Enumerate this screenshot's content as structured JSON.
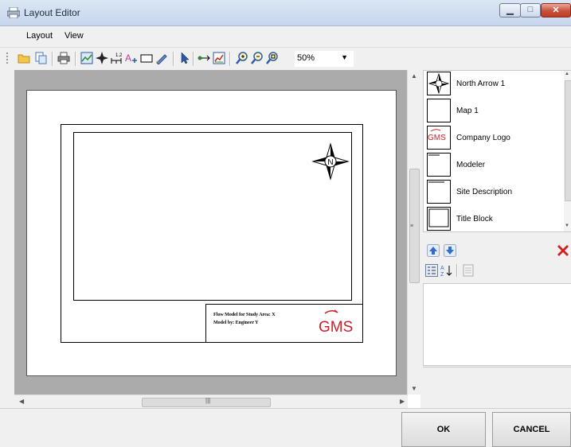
{
  "window": {
    "title": "Layout Editor"
  },
  "menu": {
    "items": [
      "Layout",
      "View"
    ]
  },
  "toolbar": {
    "zoom": "50%"
  },
  "layout": {
    "title_block": {
      "line1": "Flow Model for Study Area: X",
      "line2": "Model by: Engineer Y"
    },
    "logo_text": "GMS",
    "north_letter": "N"
  },
  "elements": [
    {
      "label": "North Arrow 1",
      "icon": "north-arrow-thumb"
    },
    {
      "label": "Map 1",
      "icon": "blank-thumb"
    },
    {
      "label": "Company Logo",
      "icon": "gms-logo-thumb"
    },
    {
      "label": "Modeler",
      "icon": "text-thumb"
    },
    {
      "label": "Site Description",
      "icon": "text-thumb"
    },
    {
      "label": "Title Block",
      "icon": "title-block-thumb"
    }
  ],
  "dialog": {
    "ok_label": "OK",
    "cancel_label": "CANCEL"
  },
  "colors": {
    "logo_red": "#c8202a",
    "delete_red": "#d4201a",
    "arrow_blue": "#2f6fc7"
  }
}
